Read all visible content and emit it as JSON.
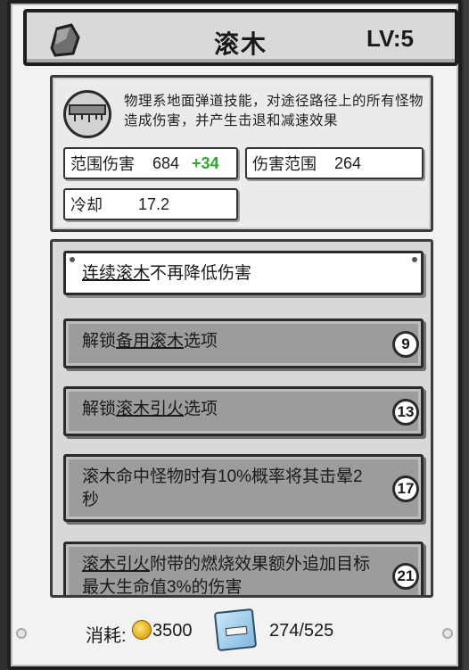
{
  "header": {
    "icon": "back-stone-icon",
    "title": "滚木",
    "level": "LV:5"
  },
  "skill": {
    "icon": "rolling-log-icon",
    "description": "物理系地面弹道技能，对途径路径上的所有怪物造成伤害，并产生击退和减速效果"
  },
  "stats": {
    "range_damage_label": "范围伤害",
    "range_damage_value": "684",
    "range_damage_bonus": "+34",
    "damage_range_label": "伤害范围",
    "damage_range_value": "264",
    "cooldown_label": "冷却",
    "cooldown_value": "17.2"
  },
  "upgrades": [
    {
      "pre": "",
      "link": "连续滚木",
      "post": "不再降低伤害",
      "badge": ""
    },
    {
      "pre": "解锁",
      "link": "备用滚木",
      "post": "选项",
      "badge": "9"
    },
    {
      "pre": "解锁",
      "link": "滚木引火",
      "post": "选项",
      "badge": "13"
    },
    {
      "pre": "滚木命中怪物时有10%概率将其击晕2秒",
      "link": "",
      "post": "",
      "badge": "17"
    },
    {
      "pre": "",
      "link": "滚木引火",
      "post": "附带的燃烧效果额外追加目标最大生命值3%的伤害",
      "badge": "21"
    }
  ],
  "footer": {
    "cost_label": "消耗:",
    "cost_value": "3500",
    "fragments": "274/525"
  },
  "colors": {
    "bonus": "#2fa62f",
    "panel": "#f2f2f0",
    "locked": "#9c9c9a"
  }
}
